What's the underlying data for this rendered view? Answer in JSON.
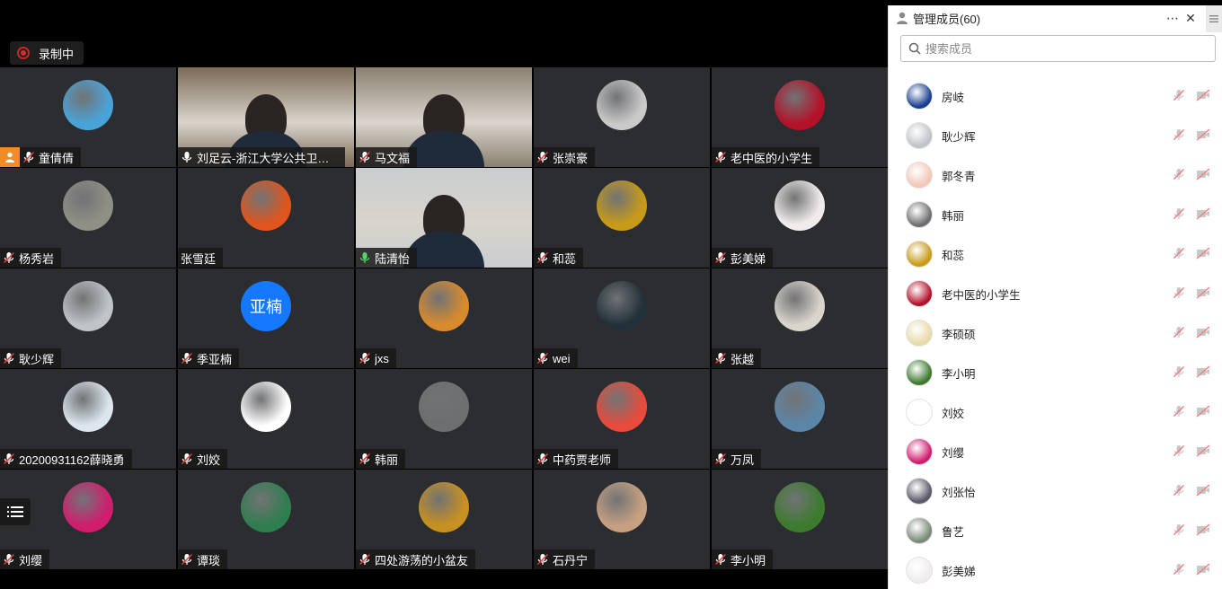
{
  "recording": {
    "label": "录制中"
  },
  "tiles": [
    {
      "name": "童倩倩",
      "host": true,
      "mic": "muted",
      "kind": "avatar",
      "color": "#4aa3d8"
    },
    {
      "name": "刘足云-浙江大学公共卫生...",
      "mic": "on",
      "kind": "video",
      "color": "#7a6a55"
    },
    {
      "name": "马文福",
      "mic": "muted",
      "kind": "video",
      "color": "#8a8070"
    },
    {
      "name": "张崇豪",
      "mic": "muted",
      "kind": "avatar",
      "color": "#c9c9c9"
    },
    {
      "name": "老中医的小学生",
      "mic": "muted",
      "kind": "avatar",
      "color": "#b3122a"
    },
    {
      "name": "杨秀岩",
      "mic": "muted",
      "kind": "avatar",
      "color": "#8f8f86"
    },
    {
      "name": "张雪廷",
      "mic": "none",
      "kind": "avatar",
      "color": "#e0551d"
    },
    {
      "name": "陆清怡",
      "mic": "active",
      "kind": "video",
      "color": "#c8cdd0"
    },
    {
      "name": "和蕊",
      "mic": "muted",
      "kind": "avatar",
      "color": "#c79a18"
    },
    {
      "name": "彭美娣",
      "mic": "muted",
      "kind": "avatar",
      "color": "#f1ecec"
    },
    {
      "name": "耿少辉",
      "mic": "muted",
      "kind": "avatar",
      "color": "#bfc4c7"
    },
    {
      "name": "季亚楠",
      "mic": "muted",
      "kind": "text",
      "text": "亚楠",
      "color": "#1677ff"
    },
    {
      "name": "jxs",
      "mic": "muted",
      "kind": "avatar",
      "color": "#d98a2c"
    },
    {
      "name": "wei",
      "mic": "muted",
      "kind": "avatar",
      "color": "#223039"
    },
    {
      "name": "张越",
      "mic": "muted",
      "kind": "avatar",
      "color": "#d9d4cc"
    },
    {
      "name": "20200931162薛晓勇",
      "mic": "muted",
      "kind": "avatar",
      "color": "#dce6ee"
    },
    {
      "name": "刘姣",
      "mic": "muted",
      "kind": "avatar",
      "color": "#ffffff"
    },
    {
      "name": "韩丽",
      "mic": "muted",
      "kind": "avatar",
      "color": "#6d6e70"
    },
    {
      "name": "中药贾老师",
      "mic": "muted",
      "kind": "avatar",
      "color": "#e84b3c"
    },
    {
      "name": "万凤",
      "mic": "muted",
      "kind": "avatar",
      "color": "#5c86a8"
    },
    {
      "name": "刘缨",
      "mic": "muted",
      "kind": "avatar",
      "color": "#d11d6e"
    },
    {
      "name": "谭琰",
      "mic": "muted",
      "kind": "avatar",
      "color": "#2f7e4f"
    },
    {
      "name": "四处游荡的小盆友",
      "mic": "muted",
      "kind": "avatar",
      "color": "#c89020"
    },
    {
      "name": "石丹宁",
      "mic": "muted",
      "kind": "avatar",
      "color": "#c7a081"
    },
    {
      "name": "李小明",
      "mic": "muted",
      "kind": "avatar",
      "color": "#3c7b2e"
    }
  ],
  "sidebar": {
    "title": "管理成员(60)",
    "search_placeholder": "搜索成员",
    "members": [
      {
        "name": "房岐",
        "color": "#1a3f8f"
      },
      {
        "name": "耿少辉",
        "color": "#bfc4c7"
      },
      {
        "name": "郭冬青",
        "color": "#f2c7b7"
      },
      {
        "name": "韩丽",
        "color": "#6d6e70"
      },
      {
        "name": "和蕊",
        "color": "#c79a18"
      },
      {
        "name": "老中医的小学生",
        "color": "#b3122a"
      },
      {
        "name": "李硕硕",
        "color": "#e8d9a8"
      },
      {
        "name": "李小明",
        "color": "#3c7b2e"
      },
      {
        "name": "刘姣",
        "color": "#ffffff"
      },
      {
        "name": "刘缨",
        "color": "#d11d6e"
      },
      {
        "name": "刘张怡",
        "color": "#5a5a6a"
      },
      {
        "name": "鲁艺",
        "color": "#7a8a7a"
      },
      {
        "name": "彭美娣",
        "color": "#f1ecec"
      }
    ]
  }
}
